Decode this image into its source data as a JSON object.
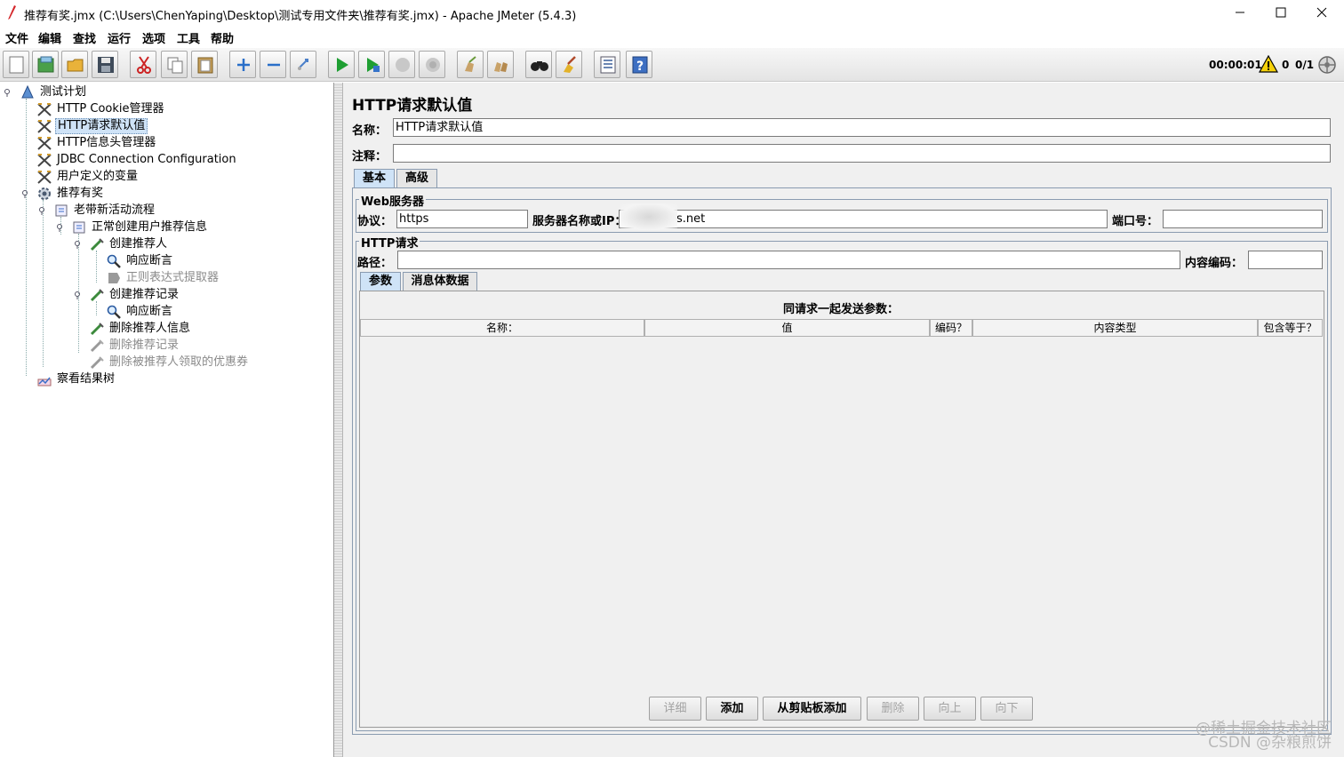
{
  "window": {
    "title": "推荐有奖.jmx (C:\\Users\\ChenYaping\\Desktop\\测试专用文件夹\\推荐有奖.jmx) - Apache JMeter (5.4.3)"
  },
  "menu": [
    "文件",
    "编辑",
    "查找",
    "运行",
    "选项",
    "工具",
    "帮助"
  ],
  "toolbar": {
    "buttons": [
      "new-icon",
      "templates-icon",
      "open-icon",
      "save-icon",
      "cut-icon",
      "copy-icon",
      "paste-icon",
      "expand-icon",
      "collapse-icon",
      "toggle-icon",
      "start-icon",
      "start-no-pause-icon",
      "stop-icon",
      "shutdown-icon",
      "clear-icon",
      "clear-all-icon",
      "search-icon",
      "reset-search-icon",
      "function-helper-icon",
      "help-icon"
    ],
    "timer": "00:00:01",
    "warnings": "0",
    "threads": "0/1"
  },
  "tree": [
    {
      "label": "测试计划"
    },
    {
      "label": "HTTP Cookie管理器"
    },
    {
      "label": "HTTP请求默认值"
    },
    {
      "label": "HTTP信息头管理器"
    },
    {
      "label": "JDBC Connection Configuration"
    },
    {
      "label": "用户定义的变量"
    },
    {
      "label": "推荐有奖"
    },
    {
      "label": "老带新活动流程"
    },
    {
      "label": "正常创建用户推荐信息"
    },
    {
      "label": "创建推荐人"
    },
    {
      "label": "响应断言"
    },
    {
      "label": "正则表达式提取器"
    },
    {
      "label": "创建推荐记录"
    },
    {
      "label": "响应断言"
    },
    {
      "label": "删除推荐人信息"
    },
    {
      "label": "删除推荐记录"
    },
    {
      "label": "删除被推荐人领取的优惠券"
    },
    {
      "label": "察看结果树"
    }
  ],
  "panel": {
    "title": "HTTP请求默认值",
    "name_label": "名称：",
    "name_value": "HTTP请求默认值",
    "comment_label": "注释：",
    "comment_value": "",
    "tabs": [
      "基本",
      "高级"
    ],
    "web_server": {
      "group_title": "Web服务器",
      "protocol_label": "协议：",
      "protocol_value": "https",
      "server_label": "服务器名称或IP：",
      "server_value": "s.net",
      "port_label": "端口号：",
      "port_value": ""
    },
    "http_request": {
      "group_title": "HTTP请求",
      "path_label": "路径：",
      "path_value": "",
      "encoding_label": "内容编码：",
      "encoding_value": ""
    },
    "subtabs": [
      "参数",
      "消息体数据"
    ],
    "params": {
      "caption": "同请求一起发送参数：",
      "columns": [
        "名称：",
        "值",
        "编码？",
        "内容类型",
        "包含等于？"
      ]
    },
    "buttons": [
      "详细",
      "添加",
      "从剪贴板添加",
      "删除",
      "向上",
      "向下"
    ]
  },
  "watermark": {
    "line1": "@稀土掘金技术社区",
    "line2": "CSDN @杂粮煎饼"
  }
}
